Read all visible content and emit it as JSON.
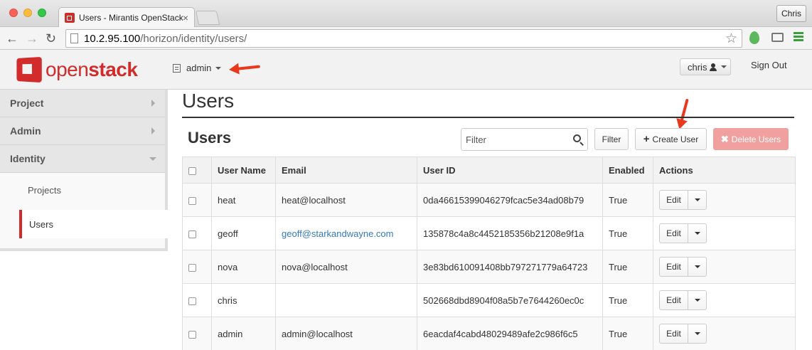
{
  "browser": {
    "tab_title": "Users - Mirantis OpenStack",
    "tab_close": "×",
    "profile_label": "Chris",
    "url_host": "10.2.95.100",
    "url_path": "/horizon/identity/users/",
    "back_glyph": "←",
    "forward_glyph": "→",
    "reload_glyph": "↻",
    "star_glyph": "☆"
  },
  "header": {
    "logo_text_light": "open",
    "logo_text_bold": "stack",
    "project_label": "admin",
    "user_label": "chris",
    "sign_out_label": "Sign Out"
  },
  "sidebar": {
    "panels": [
      {
        "label": "Project",
        "icon": "chevron-right-icon"
      },
      {
        "label": "Admin",
        "icon": "chevron-right-icon"
      },
      {
        "label": "Identity",
        "icon": "chevron-down-icon"
      }
    ],
    "items": [
      {
        "label": "Projects",
        "active": false
      },
      {
        "label": "Users",
        "active": true
      }
    ]
  },
  "main": {
    "page_title": "Users",
    "section_title": "Users",
    "filter_placeholder": "Filter",
    "filter_button": "Filter",
    "create_button": "Create User",
    "delete_button": "Delete Users",
    "columns": [
      "Email",
      "User Name",
      "User ID",
      "Enabled",
      "Actions"
    ],
    "column_labels": {
      "name": "User Name",
      "email": "Email",
      "id": "User ID",
      "enabled": "Enabled",
      "actions": "Actions"
    },
    "rows": [
      {
        "name": "heat",
        "email": "heat@localhost",
        "email_link": false,
        "id": "0da46615399046279fcac5e34ad08b79",
        "enabled": "True",
        "action": "Edit"
      },
      {
        "name": "geoff",
        "email": "geoff@starkandwayne.com",
        "email_link": true,
        "id": "135878c4a8c4452185356b21208e9f1a",
        "enabled": "True",
        "action": "Edit"
      },
      {
        "name": "nova",
        "email": "nova@localhost",
        "email_link": false,
        "id": "3e83bd610091408bb797271779a64723",
        "enabled": "True",
        "action": "Edit"
      },
      {
        "name": "chris",
        "email": "",
        "email_link": false,
        "id": "502668dbd8904f08a5b7e7644260ec0c",
        "enabled": "True",
        "action": "Edit"
      },
      {
        "name": "admin",
        "email": "admin@localhost",
        "email_link": false,
        "id": "6eacdaf4cabd48029489afe2c986f6c5",
        "enabled": "True",
        "action": "Edit"
      }
    ]
  },
  "colors": {
    "brand_red": "#d22b2b",
    "annotation_arrow": "#e8391f",
    "link_blue": "#337ab7",
    "delete_disabled": "#f0a19f"
  }
}
